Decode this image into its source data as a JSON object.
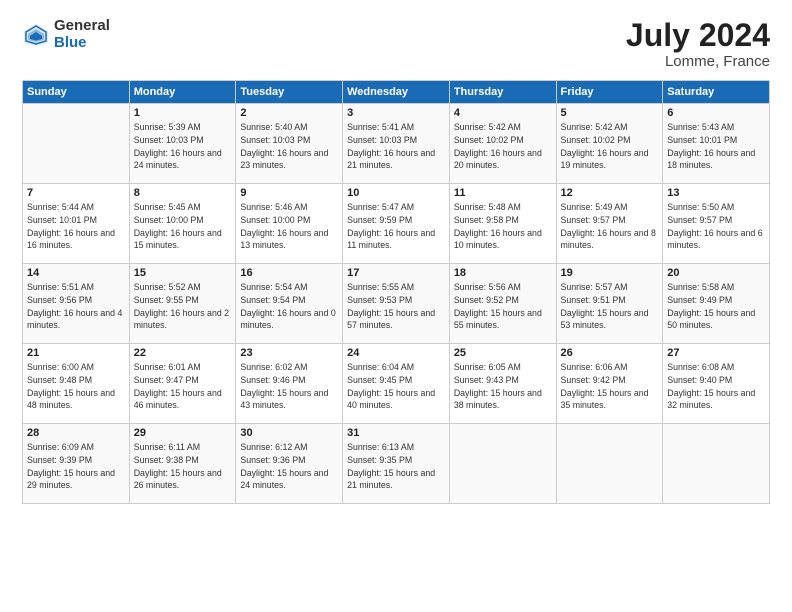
{
  "logo": {
    "general": "General",
    "blue": "Blue"
  },
  "header": {
    "month_year": "July 2024",
    "location": "Lomme, France"
  },
  "days_of_week": [
    "Sunday",
    "Monday",
    "Tuesday",
    "Wednesday",
    "Thursday",
    "Friday",
    "Saturday"
  ],
  "weeks": [
    [
      {
        "day": "",
        "sunrise": "",
        "sunset": "",
        "daylight": ""
      },
      {
        "day": "1",
        "sunrise": "Sunrise: 5:39 AM",
        "sunset": "Sunset: 10:03 PM",
        "daylight": "Daylight: 16 hours and 24 minutes."
      },
      {
        "day": "2",
        "sunrise": "Sunrise: 5:40 AM",
        "sunset": "Sunset: 10:03 PM",
        "daylight": "Daylight: 16 hours and 23 minutes."
      },
      {
        "day": "3",
        "sunrise": "Sunrise: 5:41 AM",
        "sunset": "Sunset: 10:03 PM",
        "daylight": "Daylight: 16 hours and 21 minutes."
      },
      {
        "day": "4",
        "sunrise": "Sunrise: 5:42 AM",
        "sunset": "Sunset: 10:02 PM",
        "daylight": "Daylight: 16 hours and 20 minutes."
      },
      {
        "day": "5",
        "sunrise": "Sunrise: 5:42 AM",
        "sunset": "Sunset: 10:02 PM",
        "daylight": "Daylight: 16 hours and 19 minutes."
      },
      {
        "day": "6",
        "sunrise": "Sunrise: 5:43 AM",
        "sunset": "Sunset: 10:01 PM",
        "daylight": "Daylight: 16 hours and 18 minutes."
      }
    ],
    [
      {
        "day": "7",
        "sunrise": "Sunrise: 5:44 AM",
        "sunset": "Sunset: 10:01 PM",
        "daylight": "Daylight: 16 hours and 16 minutes."
      },
      {
        "day": "8",
        "sunrise": "Sunrise: 5:45 AM",
        "sunset": "Sunset: 10:00 PM",
        "daylight": "Daylight: 16 hours and 15 minutes."
      },
      {
        "day": "9",
        "sunrise": "Sunrise: 5:46 AM",
        "sunset": "Sunset: 10:00 PM",
        "daylight": "Daylight: 16 hours and 13 minutes."
      },
      {
        "day": "10",
        "sunrise": "Sunrise: 5:47 AM",
        "sunset": "Sunset: 9:59 PM",
        "daylight": "Daylight: 16 hours and 11 minutes."
      },
      {
        "day": "11",
        "sunrise": "Sunrise: 5:48 AM",
        "sunset": "Sunset: 9:58 PM",
        "daylight": "Daylight: 16 hours and 10 minutes."
      },
      {
        "day": "12",
        "sunrise": "Sunrise: 5:49 AM",
        "sunset": "Sunset: 9:57 PM",
        "daylight": "Daylight: 16 hours and 8 minutes."
      },
      {
        "day": "13",
        "sunrise": "Sunrise: 5:50 AM",
        "sunset": "Sunset: 9:57 PM",
        "daylight": "Daylight: 16 hours and 6 minutes."
      }
    ],
    [
      {
        "day": "14",
        "sunrise": "Sunrise: 5:51 AM",
        "sunset": "Sunset: 9:56 PM",
        "daylight": "Daylight: 16 hours and 4 minutes."
      },
      {
        "day": "15",
        "sunrise": "Sunrise: 5:52 AM",
        "sunset": "Sunset: 9:55 PM",
        "daylight": "Daylight: 16 hours and 2 minutes."
      },
      {
        "day": "16",
        "sunrise": "Sunrise: 5:54 AM",
        "sunset": "Sunset: 9:54 PM",
        "daylight": "Daylight: 16 hours and 0 minutes."
      },
      {
        "day": "17",
        "sunrise": "Sunrise: 5:55 AM",
        "sunset": "Sunset: 9:53 PM",
        "daylight": "Daylight: 15 hours and 57 minutes."
      },
      {
        "day": "18",
        "sunrise": "Sunrise: 5:56 AM",
        "sunset": "Sunset: 9:52 PM",
        "daylight": "Daylight: 15 hours and 55 minutes."
      },
      {
        "day": "19",
        "sunrise": "Sunrise: 5:57 AM",
        "sunset": "Sunset: 9:51 PM",
        "daylight": "Daylight: 15 hours and 53 minutes."
      },
      {
        "day": "20",
        "sunrise": "Sunrise: 5:58 AM",
        "sunset": "Sunset: 9:49 PM",
        "daylight": "Daylight: 15 hours and 50 minutes."
      }
    ],
    [
      {
        "day": "21",
        "sunrise": "Sunrise: 6:00 AM",
        "sunset": "Sunset: 9:48 PM",
        "daylight": "Daylight: 15 hours and 48 minutes."
      },
      {
        "day": "22",
        "sunrise": "Sunrise: 6:01 AM",
        "sunset": "Sunset: 9:47 PM",
        "daylight": "Daylight: 15 hours and 46 minutes."
      },
      {
        "day": "23",
        "sunrise": "Sunrise: 6:02 AM",
        "sunset": "Sunset: 9:46 PM",
        "daylight": "Daylight: 15 hours and 43 minutes."
      },
      {
        "day": "24",
        "sunrise": "Sunrise: 6:04 AM",
        "sunset": "Sunset: 9:45 PM",
        "daylight": "Daylight: 15 hours and 40 minutes."
      },
      {
        "day": "25",
        "sunrise": "Sunrise: 6:05 AM",
        "sunset": "Sunset: 9:43 PM",
        "daylight": "Daylight: 15 hours and 38 minutes."
      },
      {
        "day": "26",
        "sunrise": "Sunrise: 6:06 AM",
        "sunset": "Sunset: 9:42 PM",
        "daylight": "Daylight: 15 hours and 35 minutes."
      },
      {
        "day": "27",
        "sunrise": "Sunrise: 6:08 AM",
        "sunset": "Sunset: 9:40 PM",
        "daylight": "Daylight: 15 hours and 32 minutes."
      }
    ],
    [
      {
        "day": "28",
        "sunrise": "Sunrise: 6:09 AM",
        "sunset": "Sunset: 9:39 PM",
        "daylight": "Daylight: 15 hours and 29 minutes."
      },
      {
        "day": "29",
        "sunrise": "Sunrise: 6:11 AM",
        "sunset": "Sunset: 9:38 PM",
        "daylight": "Daylight: 15 hours and 26 minutes."
      },
      {
        "day": "30",
        "sunrise": "Sunrise: 6:12 AM",
        "sunset": "Sunset: 9:36 PM",
        "daylight": "Daylight: 15 hours and 24 minutes."
      },
      {
        "day": "31",
        "sunrise": "Sunrise: 6:13 AM",
        "sunset": "Sunset: 9:35 PM",
        "daylight": "Daylight: 15 hours and 21 minutes."
      },
      {
        "day": "",
        "sunrise": "",
        "sunset": "",
        "daylight": ""
      },
      {
        "day": "",
        "sunrise": "",
        "sunset": "",
        "daylight": ""
      },
      {
        "day": "",
        "sunrise": "",
        "sunset": "",
        "daylight": ""
      }
    ]
  ]
}
